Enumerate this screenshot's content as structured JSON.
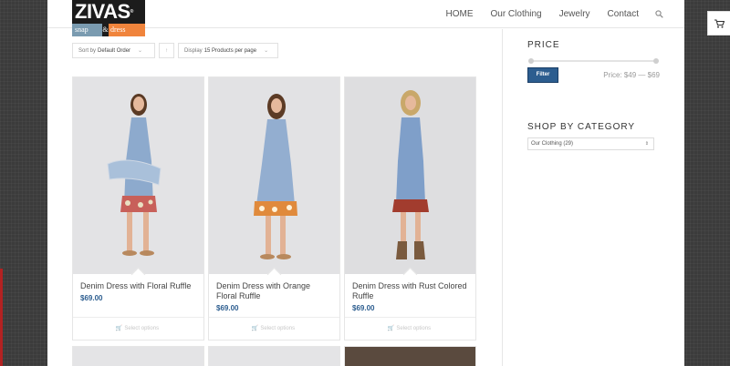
{
  "brand": {
    "logo_main": "ZIVAS",
    "logo_reg": "®",
    "logo_sub_left": "snap",
    "logo_sub_amp": "&",
    "logo_sub_right": "dress"
  },
  "nav": {
    "items": [
      "HOME",
      "Our Clothing",
      "Jewelry",
      "Contact"
    ],
    "search_icon": "search-icon"
  },
  "sorting": {
    "sort_prefix": "Sort by",
    "sort_value": "Default Order",
    "direction_icon": "sort-direction-icon",
    "display_prefix": "Display",
    "display_value": "15 Products per page"
  },
  "products": [
    {
      "name": "Denim Dress with Floral Ruffle",
      "price": "$69.00",
      "action": "Select options"
    },
    {
      "name": "Denim Dress with Orange Floral Ruffle",
      "price": "$69.00",
      "action": "Select options"
    },
    {
      "name": "Denim Dress with Rust Colored Ruffle",
      "price": "$69.00",
      "action": "Select options"
    }
  ],
  "sidebar": {
    "price_title": "PRICE",
    "filter_button": "Filter",
    "price_range_label": "Price: $49 — $69",
    "price_min": 49,
    "price_max": 69,
    "category_title": "SHOP BY CATEGORY",
    "category_selected": "Our Clothing (29)"
  },
  "colors": {
    "accent": "#2c5d8f",
    "logo_orange": "#f0843c",
    "logo_blue": "#7a9bb0"
  },
  "cart_icon": "cart-icon"
}
